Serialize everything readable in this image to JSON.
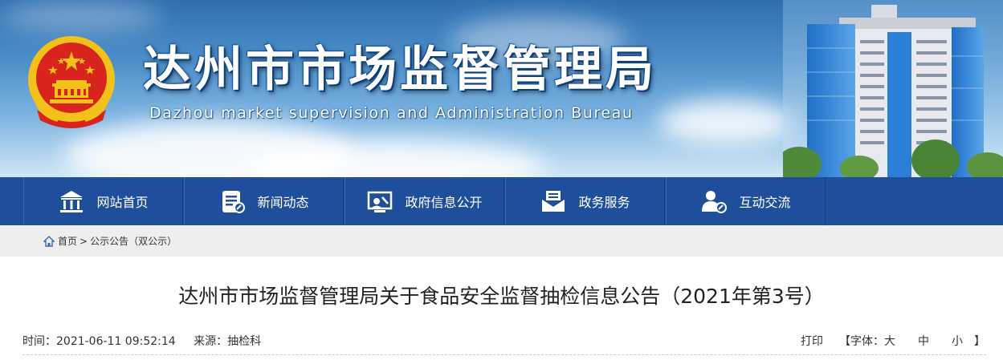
{
  "header": {
    "title": "达州市市场监督管理局",
    "subtitle": "Dazhou market supervision and Administration Bureau"
  },
  "nav": {
    "items": [
      {
        "label": "网站首页",
        "icon": "home-building-icon"
      },
      {
        "label": "新闻动态",
        "icon": "news-document-icon"
      },
      {
        "label": "政府信息公开",
        "icon": "info-disclosure-icon"
      },
      {
        "label": "政务服务",
        "icon": "service-envelope-icon"
      },
      {
        "label": "互动交流",
        "icon": "user-chat-icon"
      }
    ]
  },
  "breadcrumb": {
    "home": "首页",
    "separator": ">",
    "current": "公示公告（双公示）"
  },
  "article": {
    "title": "达州市市场监督管理局关于食品安全监督抽检信息公告（2021年第3号）",
    "time_label": "时间：2021-06-11 09:52:14",
    "source_label": "来源：抽检科"
  },
  "tools": {
    "print": "打印",
    "font_open": "【字体：",
    "size_large": "大",
    "size_medium": "中",
    "size_small": "小",
    "font_close": "】"
  },
  "colors": {
    "nav_bg": "#1f4f9a",
    "crumb_bg": "#eeeeee",
    "emblem_red": "#d8241c",
    "emblem_gold": "#f2c11a"
  }
}
